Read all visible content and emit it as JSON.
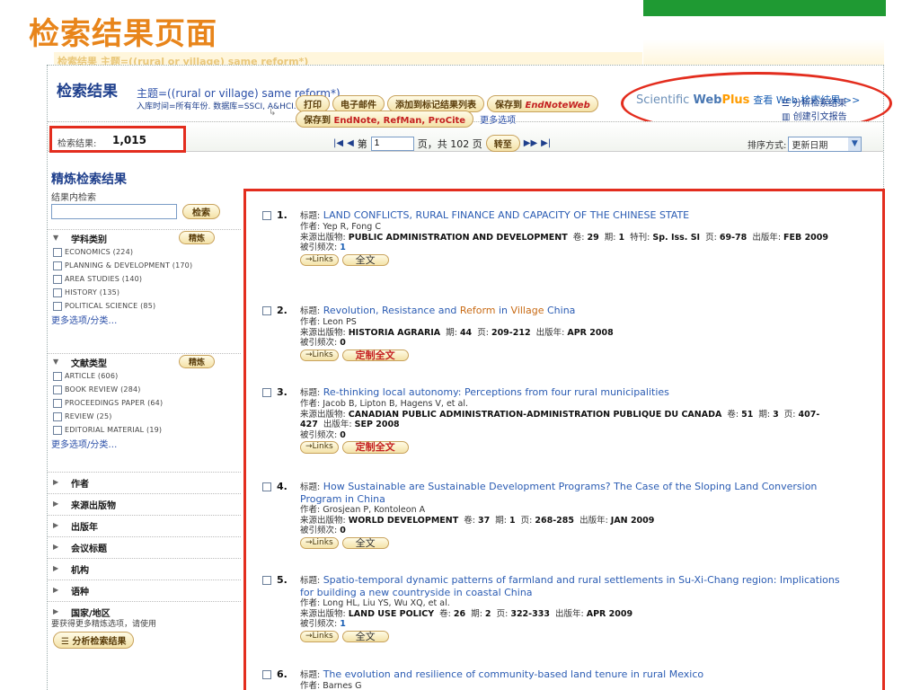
{
  "slide": {
    "title": "检索结果页面",
    "cut_text": "检索结果 主题=((rural or village) same reform*)"
  },
  "header": {
    "title": "检索结果",
    "query": "主题=((rural or village) same reform*)",
    "sub": "入库时间=所有年份. 数据库=SSCI, A&HCI.",
    "webplus": {
      "brand1": "Scientific ",
      "brand2": "Web",
      "brand3": "Plus",
      "link": "查看 Web 检索结果 >>"
    }
  },
  "nav": {
    "count_label": "检索结果:",
    "count": "1,015",
    "page_prefix": "第",
    "page_value": "1",
    "page_suffix": "页，共 102 页",
    "goto": "转至",
    "sort_label": "排序方式:",
    "sort_value": "更新日期"
  },
  "toolbar": {
    "print": "打印",
    "email": "电子邮件",
    "add_marked": "添加到标记结果列表",
    "save_endnote_web_prefix": "保存到",
    "save_endnote_web_en": "EndNote",
    "save_endnote_web_suffix": "Web",
    "save_to_prefix": "保存到",
    "save_to_endnote": "EndNote",
    "save_to_rest": ", RefMan, ProCite",
    "more_options": "更多选项",
    "analyze": "分析检索结果",
    "citation_report": "创建引文报告"
  },
  "sidebar": {
    "title": "精炼检索结果",
    "search_within": "结果内检索",
    "search_btn": "检索",
    "refine_btn": "精炼",
    "subject": {
      "label": "学科类别",
      "options": [
        "ECONOMICS (224)",
        "PLANNING & DEVELOPMENT (170)",
        "AREA STUDIES (140)",
        "HISTORY (135)",
        "POLITICAL SCIENCE (85)"
      ],
      "more": "更多选项/分类…"
    },
    "doctype": {
      "label": "文献类型",
      "options": [
        "ARTICLE (606)",
        "BOOK REVIEW (284)",
        "PROCEEDINGS PAPER (64)",
        "REVIEW (25)",
        "EDITORIAL MATERIAL (19)"
      ],
      "more": "更多选项/分类…"
    },
    "facets": [
      "作者",
      "来源出版物",
      "出版年",
      "会议标题",
      "机构",
      "语种",
      "国家/地区"
    ],
    "note": "要获得更多精炼选项，请使用",
    "analyze_btn": "分析检索结果"
  },
  "labels": {
    "title": "标题:",
    "author": "作者:",
    "source": "来源出版物:",
    "vol": "卷:",
    "issue": "期:",
    "special": "特刊:",
    "pages": "页:",
    "pubyear": "出版年:",
    "cited": "被引频次:",
    "links": "Links",
    "fulltext": "全文",
    "custom_fulltext": "定制全文"
  },
  "records": [
    {
      "num": "1.",
      "title": "LAND CONFLICTS, RURAL FINANCE AND CAPACITY OF THE CHINESE STATE",
      "authors": "Yep R, Fong C",
      "source": "PUBLIC ADMINISTRATION AND DEVELOPMENT",
      "vol": "29",
      "issue": "1",
      "special": "Sp. Iss. SI",
      "pages": "69-78",
      "year": "FEB 2009",
      "cited": "1",
      "ft": "全文"
    },
    {
      "num": "2.",
      "title_a": "Revolution, Resistance and ",
      "title_h1": "Reform",
      "title_b": " in ",
      "title_h2": "Village",
      "title_c": " China",
      "authors": "Leon PS",
      "source": "HISTORIA AGRARIA",
      "issue": "44",
      "pages": "209-212",
      "year": "APR 2008",
      "cited": "0",
      "ft": "定制全文"
    },
    {
      "num": "3.",
      "title": "Re-thinking local autonomy: Perceptions from four rural municipalities",
      "authors": "Jacob B, Lipton B, Hagens V, et al.",
      "source": "CANADIAN PUBLIC ADMINISTRATION-ADMINISTRATION PUBLIQUE DU CANADA",
      "vol": "51",
      "issue": "3",
      "pages_a": "407-",
      "pages_b": "427",
      "year": "SEP 2008",
      "cited": "0",
      "ft": "定制全文"
    },
    {
      "num": "4.",
      "title_a": "How Sustainable are Sustainable Development Programs? The Case of the Sloping Land Conversion",
      "title_b": "Program in China",
      "authors": "Grosjean P, Kontoleon A",
      "source": "WORLD DEVELOPMENT",
      "vol": "37",
      "issue": "1",
      "pages": "268-285",
      "year": "JAN 2009",
      "cited": "0",
      "ft": "全文"
    },
    {
      "num": "5.",
      "title_a": "Spatio-temporal dynamic patterns of farmland and rural settlements in Su-Xi-Chang region: Implications",
      "title_b": "for building a new countryside in coastal China",
      "authors": "Long HL, Liu YS, Wu XQ, et al.",
      "source": "LAND USE POLICY",
      "vol": "26",
      "issue": "2",
      "pages": "322-333",
      "year": "APR 2009",
      "cited": "1",
      "ft": "全文"
    },
    {
      "num": "6.",
      "title": "The evolution and resilience of community-based land tenure in rural Mexico",
      "authors": "Barnes G"
    }
  ]
}
